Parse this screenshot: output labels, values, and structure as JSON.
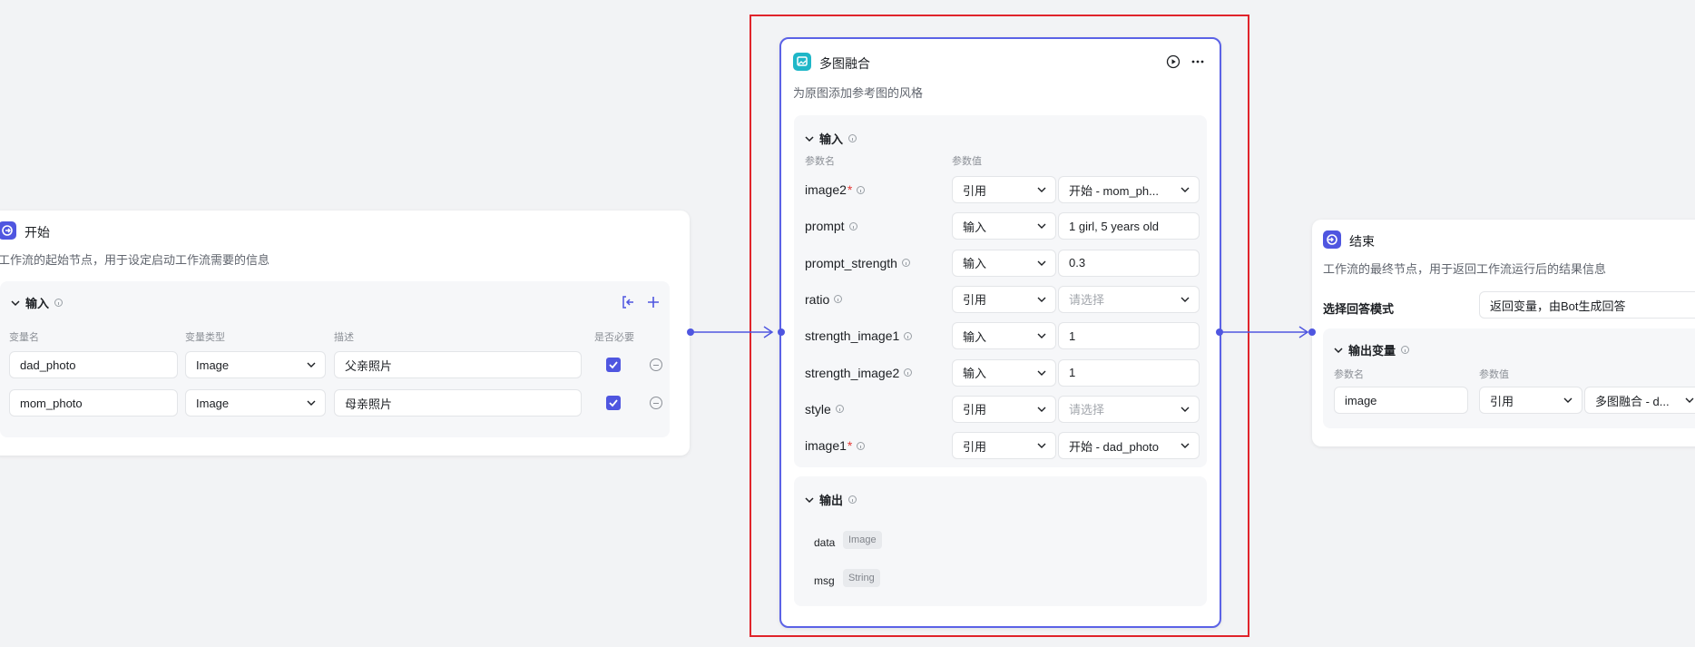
{
  "colors": {
    "accent": "#4f56e0",
    "highlight": "#e0242b",
    "canvas": "#f2f3f5"
  },
  "start_node": {
    "title": "开始",
    "desc": "工作流的起始节点，用于设定启动工作流需要的信息",
    "input_section": "输入",
    "col_name": "变量名",
    "col_type": "变量类型",
    "col_desc": "描述",
    "col_required": "是否必要",
    "rows": [
      {
        "name": "dad_photo",
        "type": "Image",
        "desc": "父亲照片"
      },
      {
        "name": "mom_photo",
        "type": "Image",
        "desc": "母亲照片"
      }
    ]
  },
  "merge_node": {
    "title": "多图融合",
    "desc": "为原图添加参考图的风格",
    "input_section": "输入",
    "col_param": "参数名",
    "col_value": "参数值",
    "params": [
      {
        "name": "image2",
        "mode": "引用",
        "value": "开始 - mom_ph...",
        "required": true
      },
      {
        "name": "prompt",
        "mode": "输入",
        "value": "1 girl, 5 years old"
      },
      {
        "name": "prompt_strength",
        "mode": "输入",
        "value": "0.3"
      },
      {
        "name": "ratio",
        "mode": "引用",
        "value": "请选择"
      },
      {
        "name": "strength_image1",
        "mode": "输入",
        "value": "1"
      },
      {
        "name": "strength_image2",
        "mode": "输入",
        "value": "1"
      },
      {
        "name": "style",
        "mode": "引用",
        "value": "请选择"
      },
      {
        "name": "image1",
        "mode": "引用",
        "value": "开始 - dad_photo",
        "required": true
      }
    ],
    "output_section": "输出",
    "outputs": [
      {
        "name": "data",
        "type": "Image"
      },
      {
        "name": "msg",
        "type": "String"
      }
    ]
  },
  "end_node": {
    "title": "结束",
    "desc": "工作流的最终节点，用于返回工作流运行后的结果信息",
    "mode_label": "选择回答模式",
    "mode_value": "返回变量，由Bot生成回答",
    "output_section": "输出变量",
    "col_param": "参数名",
    "col_value": "参数值",
    "row": {
      "name": "image",
      "mode": "引用",
      "value": "多图融合 - d..."
    }
  }
}
